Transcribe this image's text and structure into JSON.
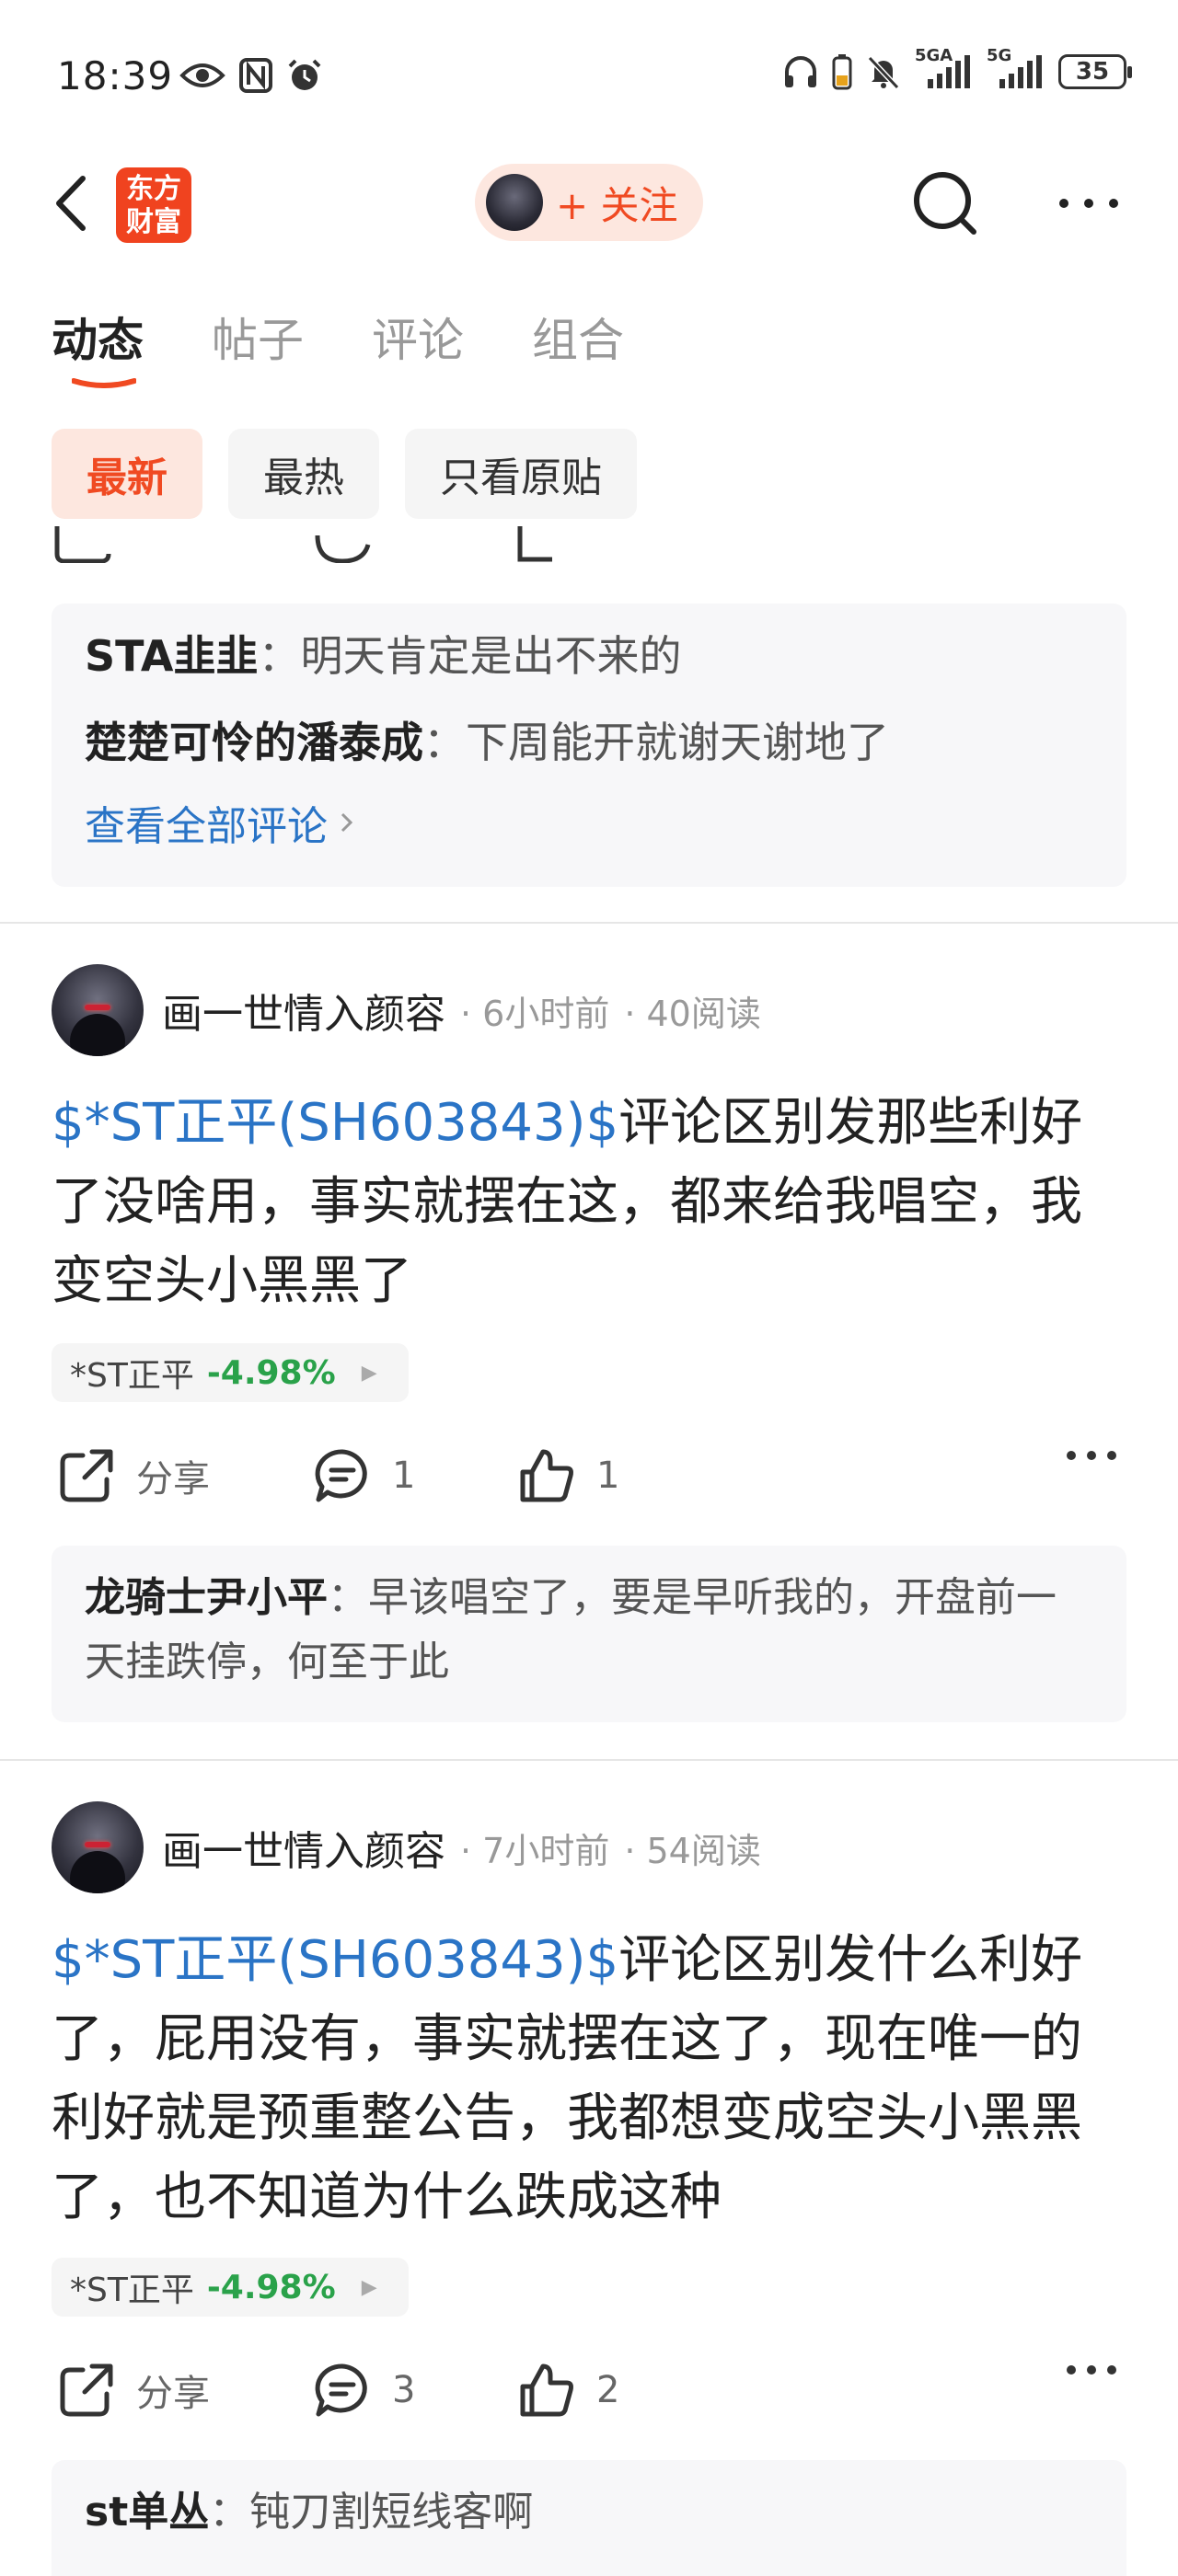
{
  "status_bar": {
    "time": "18:39",
    "battery": "35",
    "signal1_label": "5GA",
    "signal2_label": "5G"
  },
  "nav": {
    "logo_line1": "东方",
    "logo_line2": "财富",
    "follow_label": "+ 关注"
  },
  "tabs": [
    {
      "label": "动态"
    },
    {
      "label": "帖子"
    },
    {
      "label": "评论"
    },
    {
      "label": "组合"
    }
  ],
  "filters": [
    {
      "label": "最新"
    },
    {
      "label": "最热"
    },
    {
      "label": "只看原贴"
    }
  ],
  "top_comments": {
    "items": [
      {
        "name": "STA韭韭",
        "sep": "：",
        "text": "明天肯定是出不来的"
      },
      {
        "name": "楚楚可怜的潘泰成",
        "sep": "：",
        "text": "下周能开就谢天谢地了"
      }
    ],
    "view_all": "查看全部评论"
  },
  "posts": [
    {
      "author": "画一世情入颜容",
      "time": "· 6小时前",
      "reads": "· 40阅读",
      "stock_link": "$*ST正平(SH603843)$",
      "text": "评论区别发那些利好了没啥用，事实就摆在这，都来给我唱空，我变空头小黑黑了",
      "stock_tag": {
        "name": "*ST正平",
        "change": "-4.98%"
      },
      "share_label": "分享",
      "comments": "1",
      "likes": "1",
      "reply": {
        "name": "龙骑士尹小平",
        "sep": "：",
        "text": "早该唱空了，要是早听我的，开盘前一天挂跌停，何至于此"
      }
    },
    {
      "author": "画一世情入颜容",
      "time": "· 7小时前",
      "reads": "· 54阅读",
      "stock_link": "$*ST正平(SH603843)$",
      "text": "评论区别发什么利好了，屁用没有，事实就摆在这了，现在唯一的利好就是预重整公告，我都想变成空头小黑黑了，也不知道为什么跌成这种",
      "stock_tag": {
        "name": "*ST正平",
        "change": "-4.98%"
      },
      "share_label": "分享",
      "comments": "3",
      "likes": "2",
      "reply": {
        "name": "st单丛",
        "sep": "：",
        "text": "钝刀割短线客啊"
      }
    }
  ],
  "colors": {
    "accent": "#f04a22",
    "link": "#2a74c6",
    "down": "#2aa24a"
  }
}
